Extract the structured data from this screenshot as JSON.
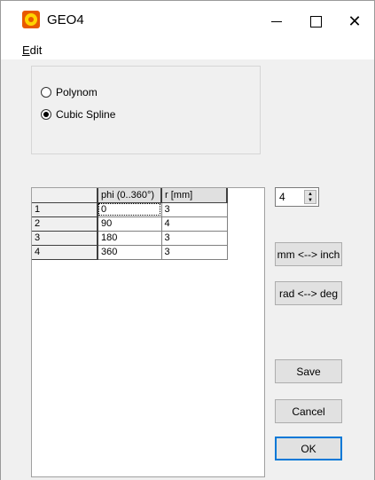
{
  "window": {
    "title": "GEO4",
    "icon": "app-target-icon",
    "controls": [
      "minimize-icon",
      "maximize-icon",
      "close-icon"
    ]
  },
  "menu": {
    "edit_prefix": "E",
    "edit_rest": "dit"
  },
  "options": {
    "polynom": "Polynom",
    "cubic_spline": "Cubic Spline",
    "selected": "Cubic Spline"
  },
  "table": {
    "headers": [
      "",
      "phi (0..360°)",
      "r [mm]"
    ],
    "rows": [
      {
        "index": "1",
        "phi": "0",
        "r": "3"
      },
      {
        "index": "2",
        "phi": "90",
        "r": "4"
      },
      {
        "index": "3",
        "phi": "180",
        "r": "3"
      },
      {
        "index": "4",
        "phi": "360",
        "r": "3"
      }
    ]
  },
  "spinner": {
    "value": "4"
  },
  "buttons": {
    "mm_inch": "mm <--> inch",
    "rad_deg": "rad <--> deg",
    "save": "Save",
    "cancel": "Cancel",
    "ok": "OK"
  }
}
